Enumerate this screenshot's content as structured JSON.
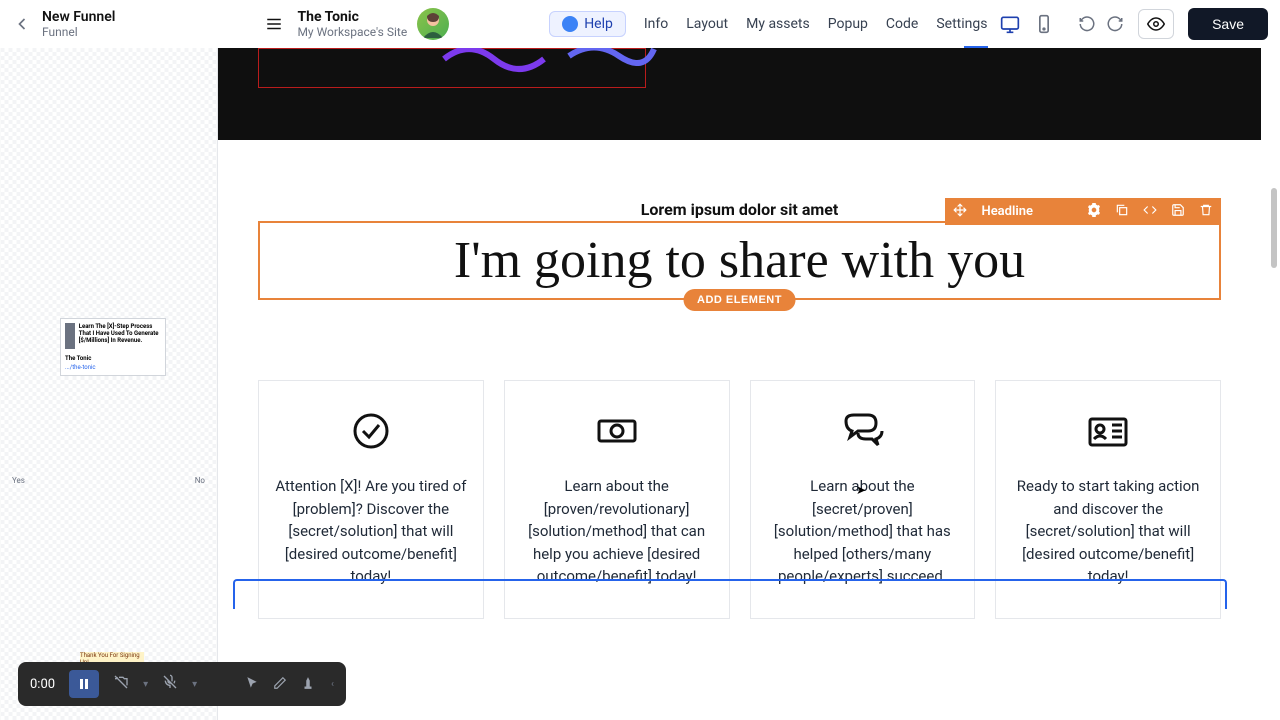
{
  "header": {
    "funnel_title": "New Funnel",
    "funnel_sub": "Funnel",
    "site_title": "The Tonic",
    "site_sub": "My Workspace's Site",
    "help_label": "Help",
    "menu": {
      "info": "Info",
      "layout": "Layout",
      "assets": "My assets",
      "popup": "Popup",
      "code": "Code",
      "settings": "Settings"
    },
    "save_label": "Save"
  },
  "sidebar": {
    "thumb_text": "Learn The [X]-Step Process That I Have Used To Generate [$/Millions] In Revenue.",
    "thumb_title": "The Tonic",
    "thumb_url": ".../the-tonic",
    "branch_yes": "Yes",
    "branch_no": "No",
    "thank_label": "Thank You For Signing Up!"
  },
  "canvas": {
    "eyebrow": "Lorem ipsum dolor sit amet",
    "headline": "I'm going to share with you",
    "add_element_label": "ADD ELEMENT",
    "toolbar_label": "Headline",
    "cards": [
      "Attention [X]! Are you tired of [problem]? Discover the [secret/solution] that will [desired outcome/benefit] today!",
      "Learn about the [proven/revolutionary] [solution/method] that can help you achieve [desired outcome/benefit] today!",
      "Learn about the [secret/proven] [solution/method] that has helped [others/many people/experts] succeed.",
      "Ready to start taking action and discover the [secret/solution] that will [desired outcome/benefit] today!"
    ]
  },
  "recorder": {
    "time": "0:00"
  }
}
